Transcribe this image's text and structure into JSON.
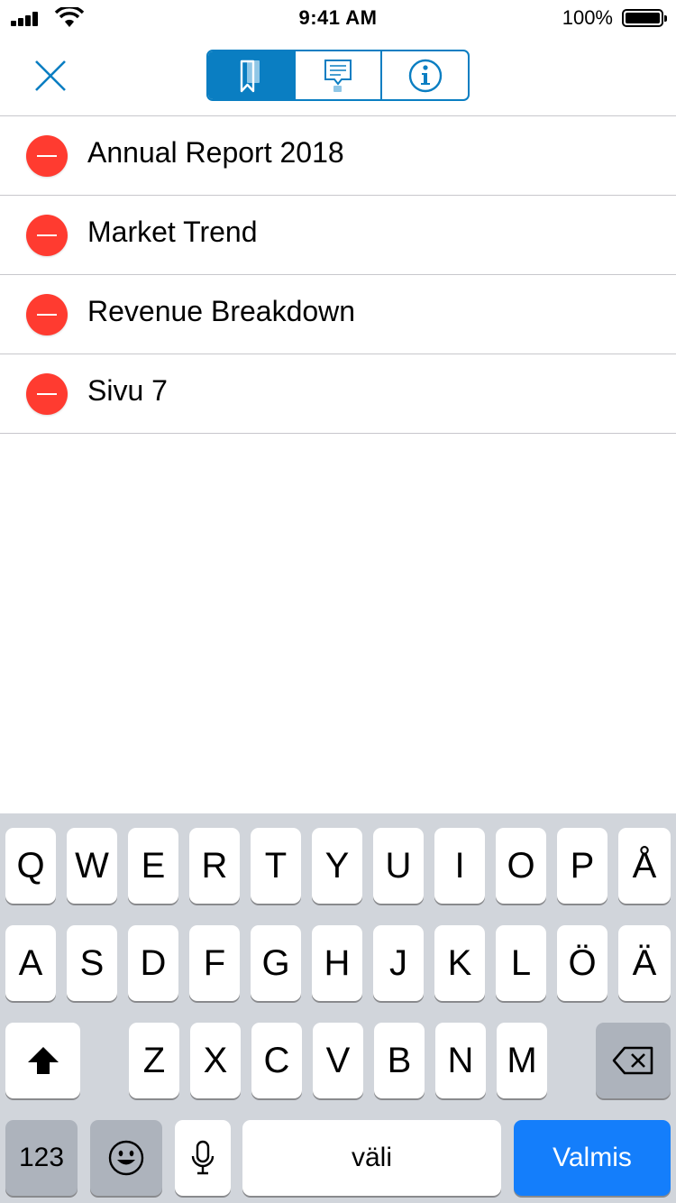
{
  "status": {
    "time": "9:41 AM",
    "battery": "100%"
  },
  "nav": {
    "close_icon": "close-icon",
    "tabs": [
      {
        "icon": "bookmark-icon",
        "active": true
      },
      {
        "icon": "annotation-comment-icon",
        "active": false
      },
      {
        "icon": "info-icon",
        "active": false
      }
    ],
    "accent": "#0a7ec2"
  },
  "bookmarks": [
    {
      "label": "Annual Report 2018"
    },
    {
      "label": "Market Trend"
    },
    {
      "label": "Revenue Breakdown"
    },
    {
      "label": "Sivu 7"
    }
  ],
  "delete_color": "#ff3b30",
  "keyboard": {
    "row1": [
      "Q",
      "W",
      "E",
      "R",
      "T",
      "Y",
      "U",
      "I",
      "O",
      "P",
      "Å"
    ],
    "row2": [
      "A",
      "S",
      "D",
      "F",
      "G",
      "H",
      "J",
      "K",
      "L",
      "Ö",
      "Ä"
    ],
    "row3": [
      "Z",
      "X",
      "C",
      "V",
      "B",
      "N",
      "M"
    ],
    "numbers": "123",
    "space": "väli",
    "done": "Valmis",
    "done_color": "#147efb"
  }
}
